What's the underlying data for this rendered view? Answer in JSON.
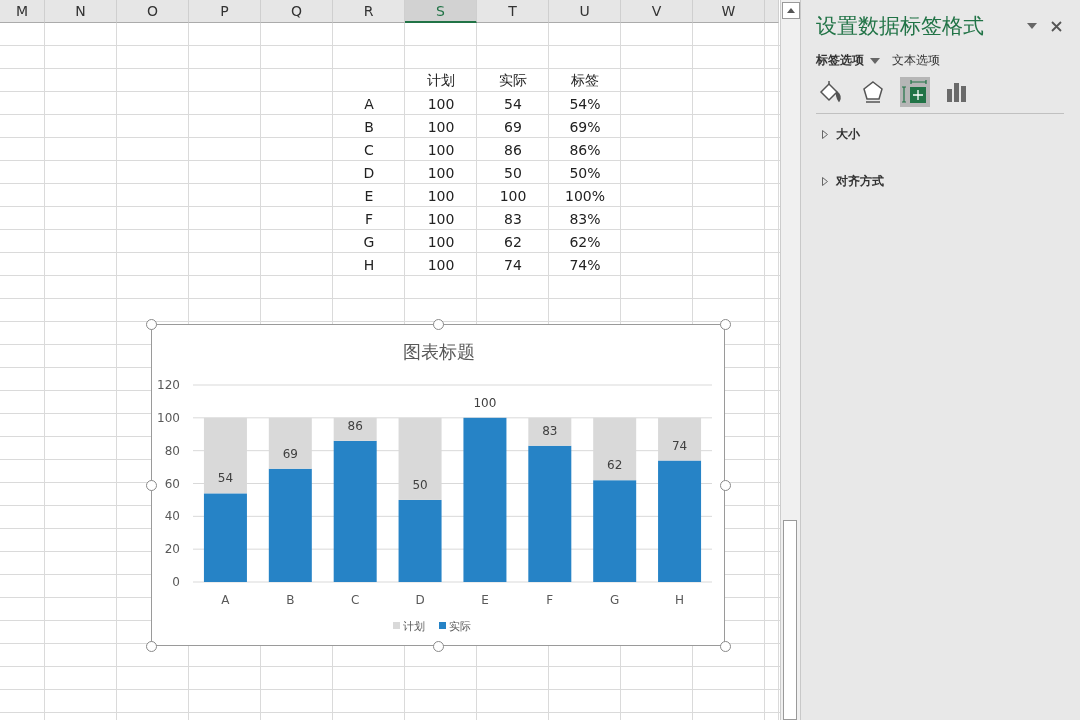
{
  "sheet": {
    "columns": [
      {
        "label": "M",
        "selected": false
      },
      {
        "label": "N",
        "selected": false
      },
      {
        "label": "O",
        "selected": false
      },
      {
        "label": "P",
        "selected": false
      },
      {
        "label": "Q",
        "selected": false
      },
      {
        "label": "R",
        "selected": false
      },
      {
        "label": "S",
        "selected": true
      },
      {
        "label": "T",
        "selected": false
      },
      {
        "label": "U",
        "selected": false
      },
      {
        "label": "V",
        "selected": false
      },
      {
        "label": "W",
        "selected": false
      }
    ],
    "table_header": [
      "计划",
      "实际",
      "标签"
    ],
    "table_rows": [
      {
        "label": "A",
        "plan": "100",
        "actual": "54",
        "tag": "54%"
      },
      {
        "label": "B",
        "plan": "100",
        "actual": "69",
        "tag": "69%"
      },
      {
        "label": "C",
        "plan": "100",
        "actual": "86",
        "tag": "86%"
      },
      {
        "label": "D",
        "plan": "100",
        "actual": "50",
        "tag": "50%"
      },
      {
        "label": "E",
        "plan": "100",
        "actual": "100",
        "tag": "100%"
      },
      {
        "label": "F",
        "plan": "100",
        "actual": "83",
        "tag": "83%"
      },
      {
        "label": "G",
        "plan": "100",
        "actual": "62",
        "tag": "62%"
      },
      {
        "label": "H",
        "plan": "100",
        "actual": "74",
        "tag": "74%"
      }
    ]
  },
  "chart": {
    "chart_data": {
      "type": "bar",
      "title": "图表标题",
      "categories": [
        "A",
        "B",
        "C",
        "D",
        "E",
        "F",
        "G",
        "H"
      ],
      "series": [
        {
          "name": "实际",
          "color": "#2683c6",
          "values": [
            54,
            69,
            86,
            50,
            100,
            83,
            62,
            74
          ]
        },
        {
          "name": "计划",
          "color": "#d9d9d9",
          "values": [
            46,
            31,
            14,
            50,
            0,
            17,
            38,
            26
          ]
        }
      ],
      "stacked": true,
      "value_labels": [
        [
          "54",
          "69",
          "86",
          "50",
          "100",
          "83",
          "62",
          "74"
        ],
        [
          null,
          null,
          null,
          null,
          null,
          null,
          null,
          null
        ]
      ],
      "ylim": [
        0,
        120
      ],
      "yticks": [
        0,
        20,
        40,
        60,
        80,
        100,
        120
      ],
      "grid": true,
      "legend": "bottom"
    }
  },
  "panel": {
    "title": "设置数据标签格式",
    "tabs": [
      {
        "label": "标签选项",
        "selected": true
      },
      {
        "label": "文本选项",
        "selected": false
      }
    ],
    "icon_tabs": [
      {
        "kind": "fill",
        "selected": false
      },
      {
        "kind": "effects",
        "selected": false
      },
      {
        "kind": "size",
        "selected": true
      },
      {
        "kind": "bars",
        "selected": false
      }
    ],
    "sections": [
      {
        "label": "大小",
        "expanded": false
      },
      {
        "label": "对齐方式",
        "expanded": false
      }
    ]
  }
}
